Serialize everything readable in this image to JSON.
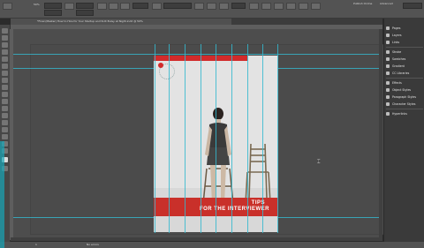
{
  "control": {
    "zoom": "50%",
    "publish_label": "Publish Online",
    "workspace": "Advanced",
    "search_placeholder": ""
  },
  "document": {
    "tab_title": "*Final (Master) How to Hire for Your Startup and SUX Bulsy at Night.indd @ 50%",
    "banner_line1": "TIPS",
    "banner_line2": "FOR THE INTERVIEWER"
  },
  "panels": [
    {
      "label": "Pages",
      "icon": "pages-icon"
    },
    {
      "label": "Layers",
      "icon": "layers-icon"
    },
    {
      "label": "Links",
      "icon": "links-icon"
    },
    {
      "label": "Stroke",
      "icon": "stroke-icon"
    },
    {
      "label": "Swatches",
      "icon": "swatches-icon"
    },
    {
      "label": "Gradient",
      "icon": "gradient-icon"
    },
    {
      "label": "CC Libraries",
      "icon": "libraries-icon"
    },
    {
      "label": "Effects",
      "icon": "effects-icon"
    },
    {
      "label": "Object Styles",
      "icon": "object-styles-icon"
    },
    {
      "label": "Paragraph Styles",
      "icon": "paragraph-styles-icon"
    },
    {
      "label": "Character Styles",
      "icon": "character-styles-icon"
    },
    {
      "label": "Hyperlinks",
      "icon": "hyperlinks-icon"
    }
  ],
  "status": {
    "page": "1",
    "preflight": "No errors"
  },
  "colors": {
    "guide": "#34b9cf",
    "accent_red": "#c9302a",
    "ui_gray": "#535353"
  }
}
